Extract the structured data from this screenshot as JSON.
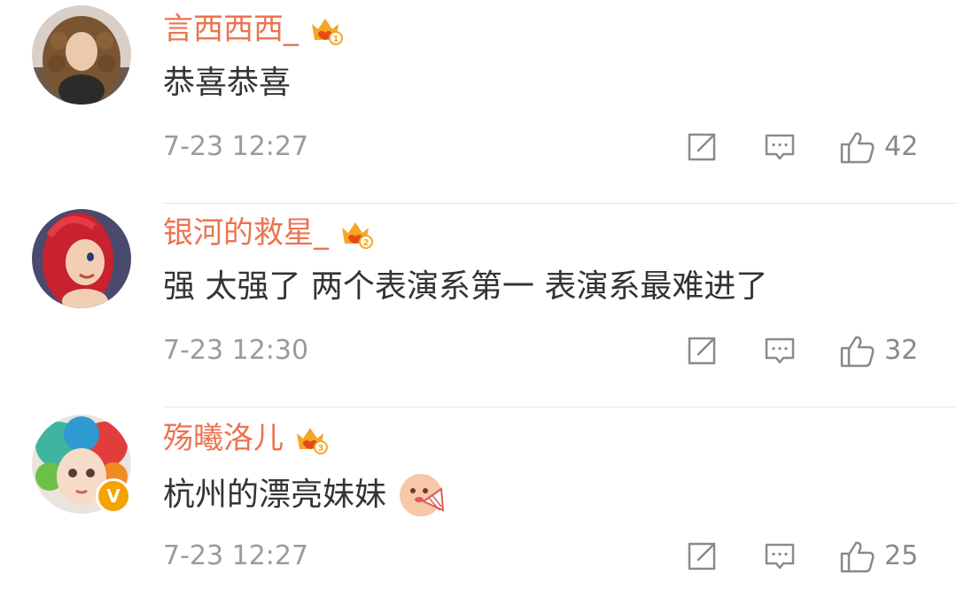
{
  "comments": [
    {
      "username": "言西西西_",
      "vip_level": "1",
      "text": "恭喜恭喜",
      "timestamp": "7-23 12:27",
      "likes": "42",
      "verified": false,
      "has_emoji": false
    },
    {
      "username": "银河的救星_",
      "vip_level": "2",
      "text": "强 太强了 两个表演系第一 表演系最难进了",
      "timestamp": "7-23 12:30",
      "likes": "32",
      "verified": false,
      "has_emoji": false
    },
    {
      "username": "殇曦洛儿",
      "vip_level": "3",
      "text": "杭州的漂亮妹妹",
      "timestamp": "7-23 12:27",
      "likes": "25",
      "verified": true,
      "verified_label": "V",
      "has_emoji": true
    }
  ],
  "colors": {
    "username": "#eb7350",
    "content": "#333333",
    "meta": "#9b9b9b",
    "icon": "#8a8a8a",
    "crown": "#f5a623",
    "verified": "#f4a300",
    "divider": "#e6e6e6"
  },
  "icons": {
    "repost": "repost-icon",
    "reply": "comment-icon",
    "like": "thumbs-up-icon",
    "vip": "crown-icon"
  }
}
